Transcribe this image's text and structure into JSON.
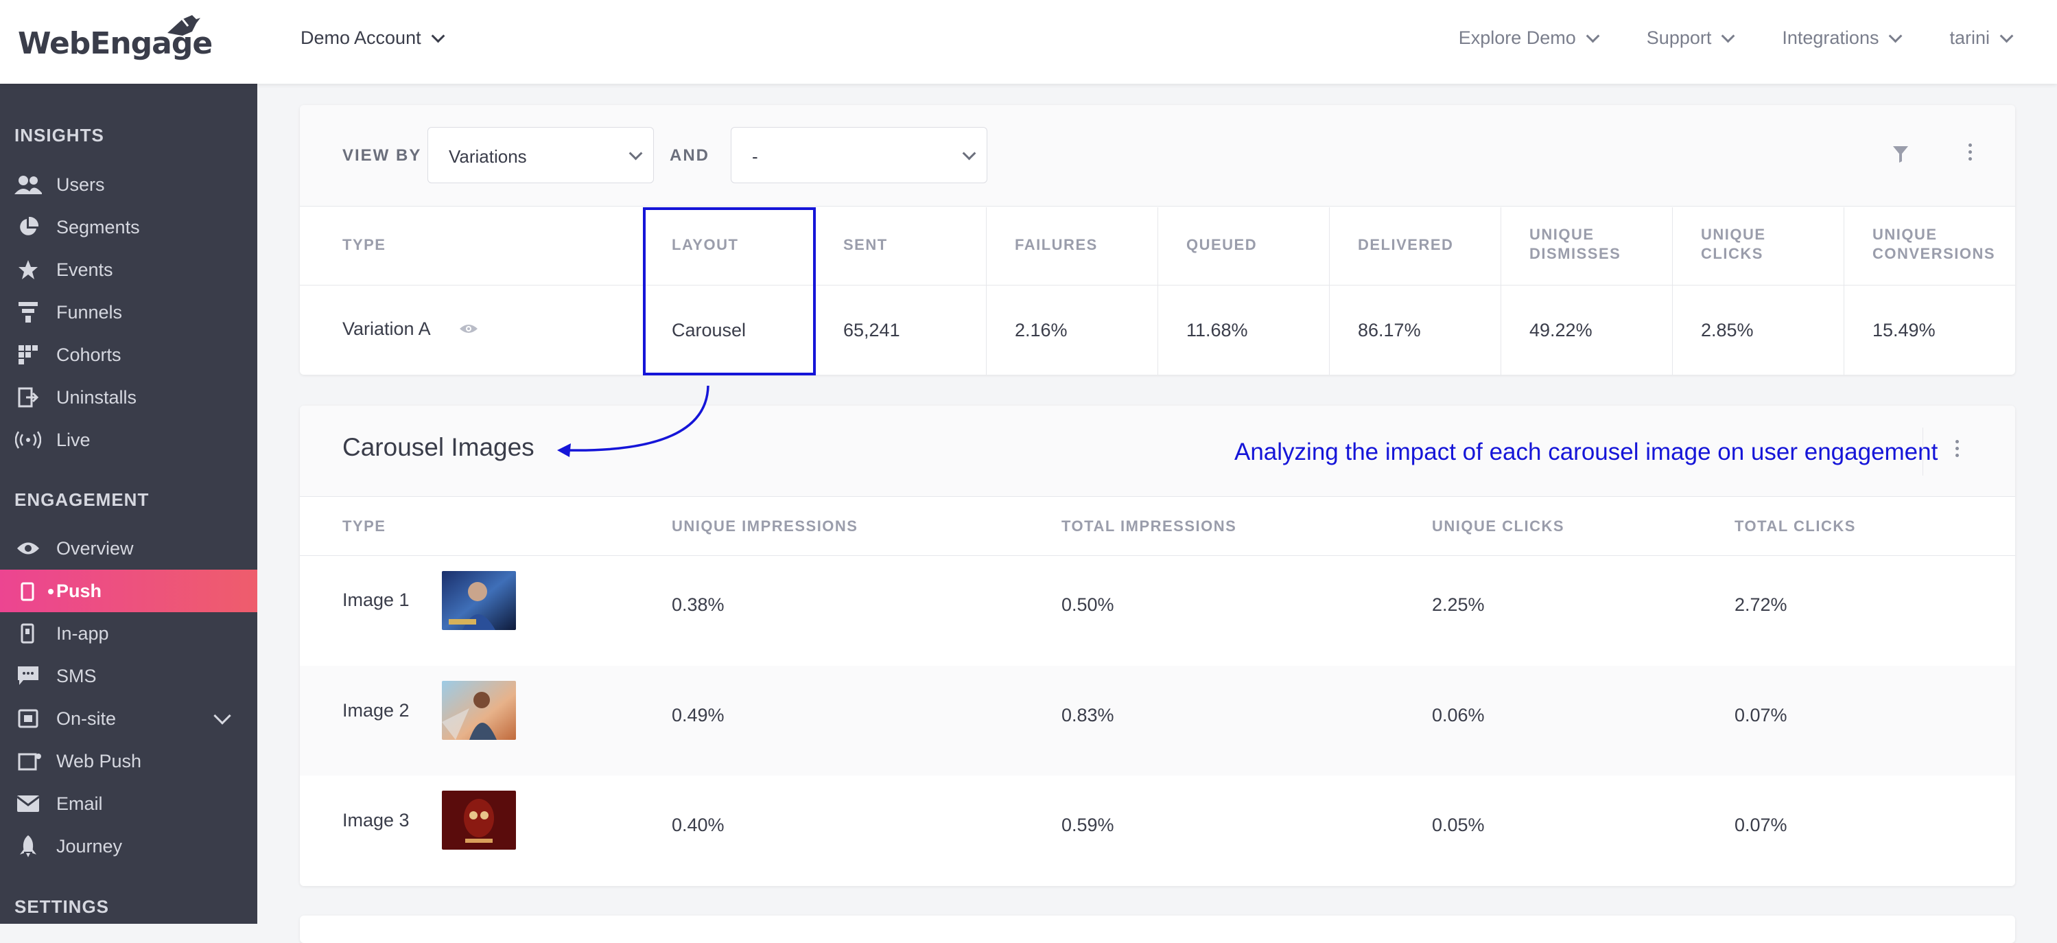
{
  "header": {
    "logo_text": "WebEngage",
    "account": "Demo Account",
    "nav": [
      "Explore Demo",
      "Support",
      "Integrations",
      "tarini"
    ]
  },
  "sidebar": {
    "insights_title": "INSIGHTS",
    "insights": [
      {
        "label": "Users",
        "icon": "users-icon"
      },
      {
        "label": "Segments",
        "icon": "pie-icon"
      },
      {
        "label": "Events",
        "icon": "star-icon"
      },
      {
        "label": "Funnels",
        "icon": "funnel-icon"
      },
      {
        "label": "Cohorts",
        "icon": "grid-icon"
      },
      {
        "label": "Uninstalls",
        "icon": "exit-icon"
      },
      {
        "label": "Live",
        "icon": "broadcast-icon"
      }
    ],
    "engagement_title": "ENGAGEMENT",
    "engagement": [
      {
        "label": "Overview",
        "icon": "eye-icon"
      },
      {
        "label": "Push",
        "icon": "mobile-icon",
        "active": true
      },
      {
        "label": "In-app",
        "icon": "tablet-icon"
      },
      {
        "label": "SMS",
        "icon": "chat-icon"
      },
      {
        "label": "On-site",
        "icon": "window-icon",
        "expandable": true
      },
      {
        "label": "Web Push",
        "icon": "browser-icon"
      },
      {
        "label": "Email",
        "icon": "mail-icon"
      },
      {
        "label": "Journey",
        "icon": "rocket-icon"
      }
    ],
    "settings_title": "SETTINGS"
  },
  "filters": {
    "view_by_label": "VIEW BY",
    "view_by_value": "Variations",
    "and_label": "AND",
    "and_value": "-"
  },
  "variation_table": {
    "columns": [
      "TYPE",
      "LAYOUT",
      "SENT",
      "FAILURES",
      "QUEUED",
      "DELIVERED",
      "UNIQUE DISMISSES",
      "UNIQUE CLICKS",
      "UNIQUE CONVERSIONS"
    ],
    "row": [
      "Variation A",
      "Carousel",
      "65,241",
      "2.16%",
      "11.68%",
      "86.17%",
      "49.22%",
      "2.85%",
      "15.49%"
    ]
  },
  "carousel": {
    "title": "Carousel Images",
    "annotation": "Analyzing the impact of each carousel image on user engagement",
    "columns": [
      "TYPE",
      "UNIQUE IMPRESSIONS",
      "TOTAL IMPRESSIONS",
      "UNIQUE CLICKS",
      "TOTAL CLICKS"
    ],
    "rows": [
      {
        "type": "Image 1",
        "values": [
          "0.38%",
          "0.50%",
          "2.25%",
          "2.72%"
        ]
      },
      {
        "type": "Image 2",
        "values": [
          "0.49%",
          "0.83%",
          "0.06%",
          "0.07%"
        ]
      },
      {
        "type": "Image 3",
        "values": [
          "0.40%",
          "0.59%",
          "0.05%",
          "0.07%"
        ]
      }
    ]
  },
  "colors": {
    "sidebar_bg": "#3a3d4a",
    "active_gradient_start": "#ec4591",
    "active_gradient_end": "#ee5d6c",
    "annotation": "#1515d8"
  }
}
